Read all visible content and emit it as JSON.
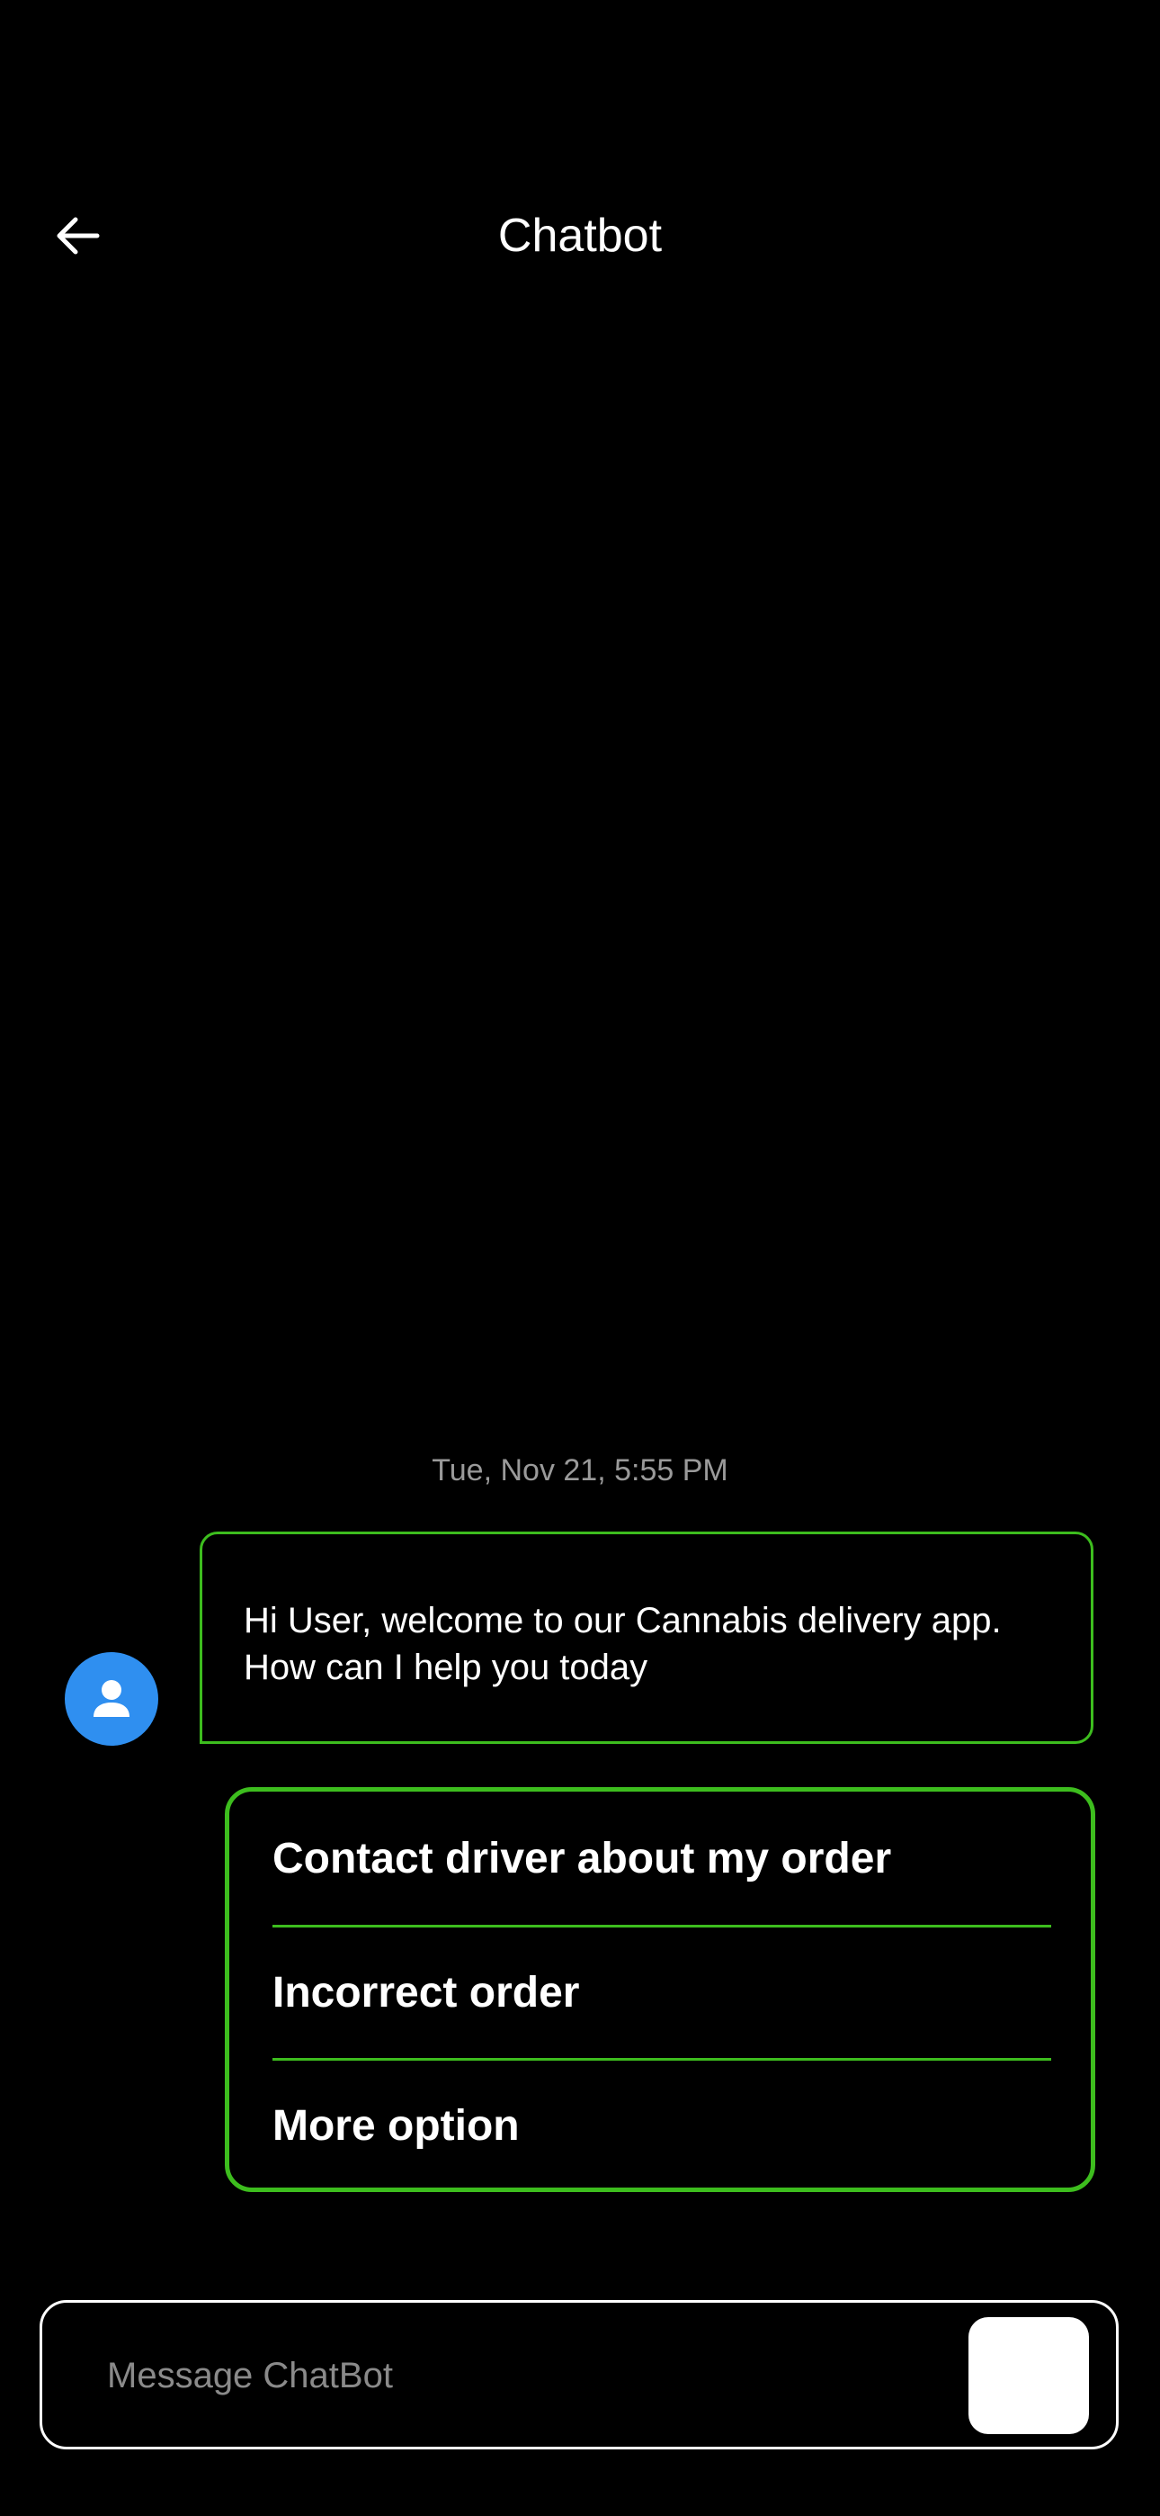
{
  "header": {
    "title": "Chatbot",
    "back_icon": "arrow-left-icon"
  },
  "chat": {
    "timestamp": "Tue, Nov 21, 5:55 PM",
    "avatar_icon": "person-icon",
    "bot_message": "Hi User, welcome to our Cannabis delivery app. How can I help you today",
    "options": [
      {
        "label": "Contact driver about my order"
      },
      {
        "label": "Incorrect order"
      },
      {
        "label": "More option"
      }
    ]
  },
  "composer": {
    "placeholder": "Message ChatBot",
    "value": "",
    "send_icon": "send-icon"
  },
  "colors": {
    "background": "#000000",
    "accent_green": "#3dbd1e",
    "avatar_blue": "#2f8ff0",
    "timestamp_gray": "#9a9a9a",
    "text": "#ffffff"
  }
}
